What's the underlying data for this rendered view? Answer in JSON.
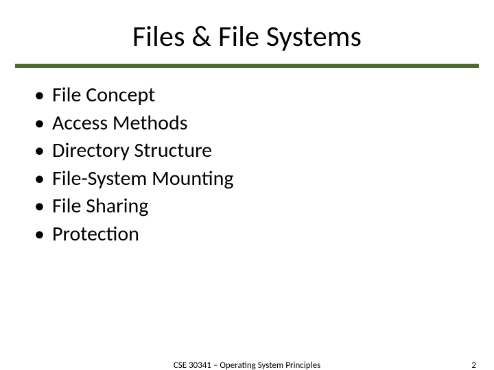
{
  "title": "Files & File Systems",
  "bullets": [
    "File Concept",
    "Access Methods",
    "Directory Structure",
    "File-System Mounting",
    "File Sharing",
    "Protection"
  ],
  "footer": {
    "course": "CSE 30341 – Operating System Principles",
    "page": "2"
  }
}
